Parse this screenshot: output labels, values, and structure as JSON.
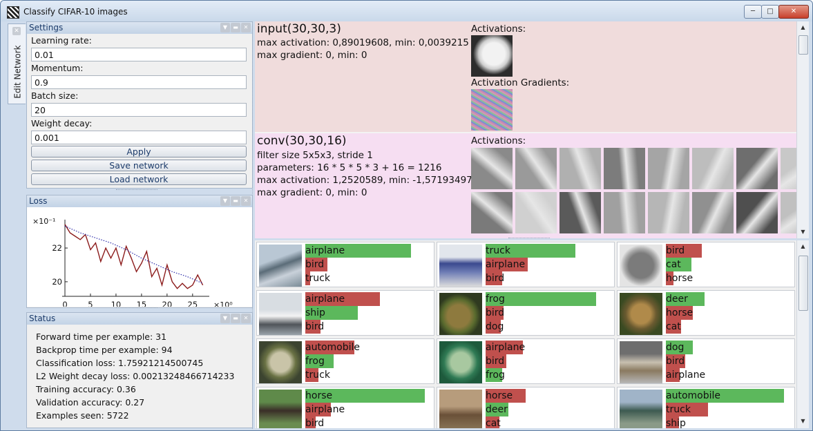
{
  "window": {
    "title": "Classify CIFAR-10 images",
    "icon": "checker-app-icon"
  },
  "side_tab": {
    "label": "Edit Network"
  },
  "settings": {
    "title": "Settings",
    "learning_rate_label": "Learning rate:",
    "learning_rate": "0.01",
    "momentum_label": "Momentum:",
    "momentum": "0.9",
    "batch_size_label": "Batch size:",
    "batch_size": "20",
    "weight_decay_label": "Weight decay:",
    "weight_decay": "0.001",
    "apply": "Apply",
    "save": "Save network",
    "load": "Load network"
  },
  "loss": {
    "title": "Loss",
    "chart_data": {
      "type": "line",
      "y_multiplier": "×10⁻¹",
      "x_multiplier": "×10⁰",
      "x_ticks": [
        "0",
        "5",
        "10",
        "15",
        "20",
        "25"
      ],
      "y_ticks": [
        "22",
        "20"
      ],
      "ylim": [
        19.3,
        23.6
      ],
      "xlim": [
        0,
        28
      ],
      "series": [
        {
          "color": "#8b1a1a",
          "style": "solid",
          "x": [
            0,
            1,
            2,
            3,
            4,
            5,
            6,
            7,
            8,
            9,
            10,
            11,
            12,
            13,
            14,
            15,
            16,
            17,
            18,
            19,
            20,
            21,
            22,
            23,
            24,
            25,
            26,
            27
          ],
          "y": [
            23.4,
            22.9,
            22.7,
            22.5,
            22.8,
            21.9,
            22.3,
            21.2,
            22.0,
            21.4,
            22.0,
            21.0,
            22.1,
            21.4,
            20.6,
            21.1,
            21.8,
            20.3,
            20.8,
            19.8,
            21.0,
            20.0,
            19.6,
            19.9,
            19.6,
            19.8,
            20.4,
            19.8
          ]
        },
        {
          "color": "#2b2ba8",
          "style": "dotted",
          "x": [
            0,
            3,
            6,
            9,
            12,
            15,
            18,
            21,
            24,
            27
          ],
          "y": [
            23.3,
            22.9,
            22.6,
            22.3,
            21.9,
            21.4,
            21.0,
            20.6,
            20.3,
            19.9
          ]
        }
      ]
    }
  },
  "status": {
    "title": "Status",
    "lines": [
      "Forward time per example: 31",
      "Backprop time per example: 94",
      "Classification loss: 1.75921214500745",
      "L2 Weight decay loss: 0.00213248466714233",
      "Training accuracy: 0.36",
      "Validation accuracy: 0.27",
      "Examples seen: 5722"
    ]
  },
  "layers": [
    {
      "name": "input(30,30,3)",
      "info": [
        "max activation: 0,89019608, min: 0,0039215",
        "max gradient: 0, min: 0"
      ],
      "activations_label": "Activations:",
      "gradients_label": "Activation Gradients:"
    },
    {
      "name": "conv(30,30,16)",
      "info": [
        "filter size 5x5x3, stride 1",
        "parameters: 16 * 5 * 5 * 3 + 16 = 1216",
        "max activation: 1,2520589, min: -1,57193497",
        "max gradient: 0, min: 0"
      ],
      "activations_label": "Activations:"
    }
  ],
  "predictions": [
    {
      "labels": [
        "airplane",
        "bird",
        "truck"
      ],
      "scores": [
        0.82,
        0.17,
        0.04
      ],
      "correct": 0
    },
    {
      "labels": [
        "truck",
        "airplane",
        "bird"
      ],
      "scores": [
        0.7,
        0.33,
        0.13
      ],
      "correct": 0
    },
    {
      "labels": [
        "bird",
        "cat",
        "horse"
      ],
      "scores": [
        0.28,
        0.2,
        0.06
      ],
      "correct": 1
    },
    {
      "labels": [
        "airplane",
        "ship",
        "bird"
      ],
      "scores": [
        0.58,
        0.41,
        0.12
      ],
      "correct": 1
    },
    {
      "labels": [
        "frog",
        "bird",
        "dog"
      ],
      "scores": [
        0.86,
        0.14,
        0.12
      ],
      "correct": 0
    },
    {
      "labels": [
        "deer",
        "horse",
        "cat"
      ],
      "scores": [
        0.3,
        0.21,
        0.12
      ],
      "correct": 0
    },
    {
      "labels": [
        "automobile",
        "frog",
        "truck"
      ],
      "scores": [
        0.38,
        0.22,
        0.1
      ],
      "correct": 1
    },
    {
      "labels": [
        "airplane",
        "bird",
        "frog"
      ],
      "scores": [
        0.29,
        0.16,
        0.13
      ],
      "correct": 2
    },
    {
      "labels": [
        "dog",
        "bird",
        "airplane"
      ],
      "scores": [
        0.21,
        0.15,
        0.11
      ],
      "correct": 0
    },
    {
      "labels": [
        "horse",
        "airplane",
        "bird"
      ],
      "scores": [
        0.93,
        0.2,
        0.08
      ],
      "correct": 0
    },
    {
      "labels": [
        "horse",
        "deer",
        "cat"
      ],
      "scores": [
        0.31,
        0.18,
        0.11
      ],
      "correct": 1
    },
    {
      "labels": [
        "automobile",
        "truck",
        "ship"
      ],
      "scores": [
        0.92,
        0.33,
        0.1
      ],
      "correct": 0
    }
  ],
  "colors": {
    "correct": "#5cb85c",
    "wrong": "#c0504d",
    "input_bg": "#f0dcdc",
    "conv_bg": "#f6def2"
  }
}
